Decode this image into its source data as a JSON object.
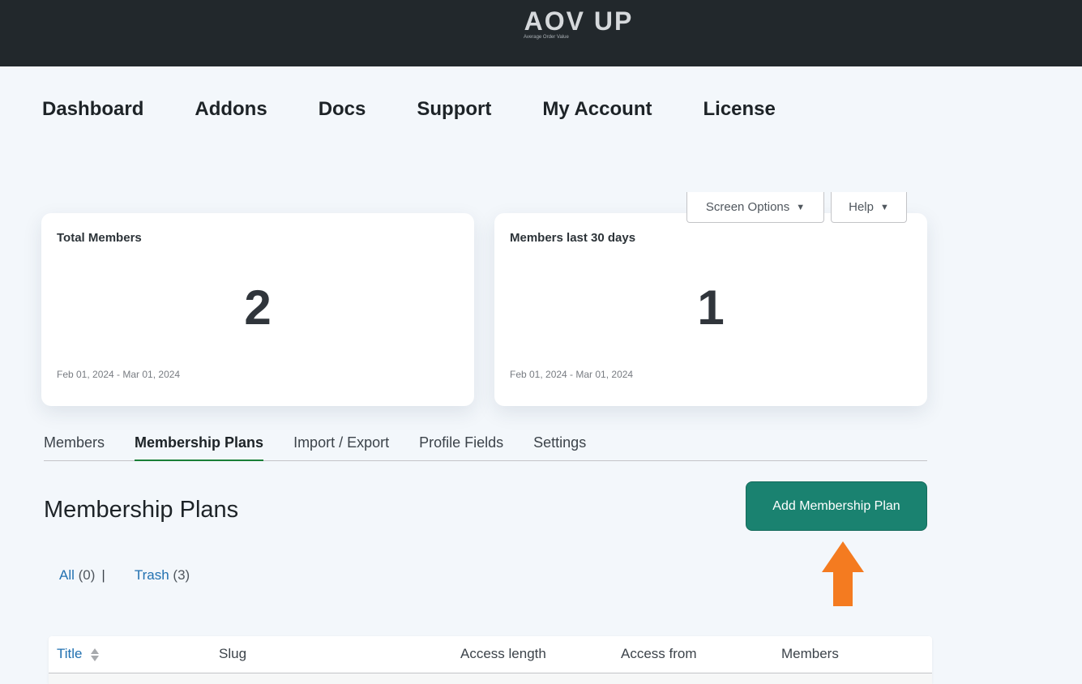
{
  "brand": {
    "logo": "AOV UP",
    "tagline": "Average Order Value"
  },
  "nav": [
    {
      "label": "Dashboard"
    },
    {
      "label": "Addons"
    },
    {
      "label": "Docs"
    },
    {
      "label": "Support"
    },
    {
      "label": "My Account"
    },
    {
      "label": "License"
    }
  ],
  "screen_options": {
    "label": "Screen Options"
  },
  "help": {
    "label": "Help"
  },
  "cards": [
    {
      "title": "Total Members",
      "value": "2",
      "range": "Feb 01, 2024 - Mar 01, 2024"
    },
    {
      "title": "Members last 30 days",
      "value": "1",
      "range": "Feb 01, 2024 - Mar 01, 2024"
    }
  ],
  "tabs": [
    {
      "label": "Members",
      "active": false
    },
    {
      "label": "Membership Plans",
      "active": true
    },
    {
      "label": "Import / Export",
      "active": false
    },
    {
      "label": "Profile Fields",
      "active": false
    },
    {
      "label": "Settings",
      "active": false
    }
  ],
  "section": {
    "title": "Membership Plans",
    "add_button": "Add Membership Plan"
  },
  "filters": {
    "all": {
      "label": "All",
      "count": "(0)"
    },
    "separator": "|",
    "trash": {
      "label": "Trash",
      "count": "(3)"
    }
  },
  "table": {
    "columns": [
      "Title",
      "Slug",
      "Access length",
      "Access from",
      "Members"
    ]
  },
  "colors": {
    "topbar": "#22282c",
    "accent": "#1a8270",
    "arrow": "#f47b20",
    "link": "#2271b1",
    "active_tab": "#1a7f37"
  },
  "icons": {
    "caret": "caret-down-icon",
    "sort": "sort-icon",
    "arrow": "arrow-up-icon"
  }
}
